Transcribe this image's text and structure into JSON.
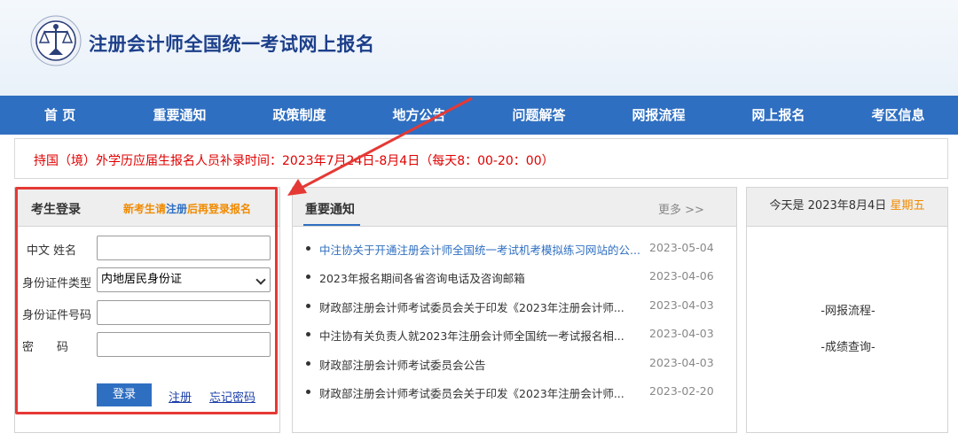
{
  "header": {
    "title": "注册会计师全国统一考试网上报名",
    "logo_icon": "cicpa-emblem-icon"
  },
  "nav": {
    "items": [
      "首 页",
      "重要通知",
      "政策制度",
      "地方公告",
      "问题解答",
      "网报流程",
      "网上报名",
      "考区信息"
    ]
  },
  "notice": {
    "text": "持国（境）外学历应届生报名人员补录时间：2023年7月24日-8月4日（每天8：00-20：00）",
    "color": "#e00000"
  },
  "login": {
    "title": "考生登录",
    "hint_prefix": "新考生请",
    "hint_link": "注册",
    "hint_suffix": "后再登录报名",
    "name_label": "中文 姓名",
    "id_type_label": "身份证件类型",
    "id_type_selected": "内地居民身份证",
    "id_number_label": "身份证件号码",
    "password_label": "密　　码",
    "login_button": "登录",
    "register_link": "注册",
    "forgot_link": "忘记密码"
  },
  "news": {
    "title": "重要通知",
    "more": "更多 >>",
    "items": [
      {
        "title": "中注协关于开通注册会计师全国统一考试机考模拟练习网站的公...",
        "date": "2023-05-04"
      },
      {
        "title": "2023年报名期间各省咨询电话及咨询邮箱",
        "date": "2023-04-06"
      },
      {
        "title": "财政部注册会计师考试委员会关于印发《2023年注册会计师...",
        "date": "2023-04-03"
      },
      {
        "title": "中注协有关负责人就2023年注册会计师全国统一考试报名相...",
        "date": "2023-04-03"
      },
      {
        "title": "财政部注册会计师考试委员会公告",
        "date": "2023-04-03"
      },
      {
        "title": "财政部注册会计师考试委员会关于印发《2023年注册会计师...",
        "date": "2023-02-20"
      }
    ]
  },
  "sidebar": {
    "today_prefix": "今天是 2023年8月4日",
    "weekday": "星期五",
    "links": [
      "-网报流程-",
      "-成绩查询-"
    ]
  },
  "colors": {
    "nav_bg": "#2f6fc1",
    "accent_orange": "#f08a00",
    "highlight_red": "#e53935"
  }
}
